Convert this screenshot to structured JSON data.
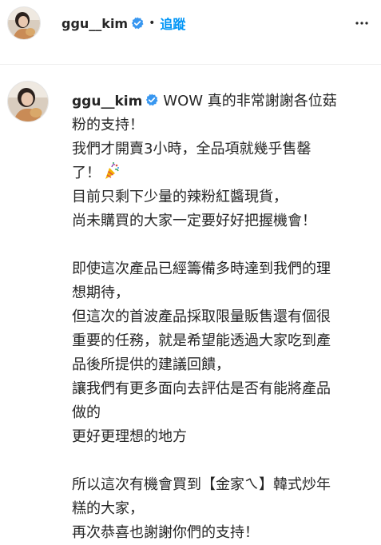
{
  "header": {
    "username": "ggu__kim",
    "separator": "•",
    "follow_label": "追蹤",
    "more_icon": "more-horizontal-icon",
    "verified_icon": "verified-badge-icon"
  },
  "caption": {
    "username": "ggu__kim",
    "first_line_text": "WOW 真的非常謝謝各位菇",
    "lines": [
      "粉的支持！",
      "我們才開賣3小時，全品項就幾乎售罄",
      "了！",
      "目前只剩下少量的辣粉紅醬現貨，",
      "尚未購買的大家一定要好好把握機會！",
      "",
      "即使這次產品已經籌備多時達到我們的理",
      "想期待，",
      "但這次的首波產品採取限量販售還有個很",
      "重要的任務，就是希望能透過大家吃到產",
      "品後所提供的建議回饋，",
      "讓我們有更多面向去評估是否有能將產品",
      "做的",
      "更好更理想的地方",
      "",
      "所以這次有機會買到【金家ㄟ】韓式炒年",
      "糕的大家，",
      "再次恭喜也謝謝你們的支持！"
    ],
    "party_emoji": "party-popper-icon"
  },
  "colors": {
    "text": "#262626",
    "link_blue": "#0095f6",
    "verified_blue": "#3897f0",
    "divider": "#efefef"
  }
}
